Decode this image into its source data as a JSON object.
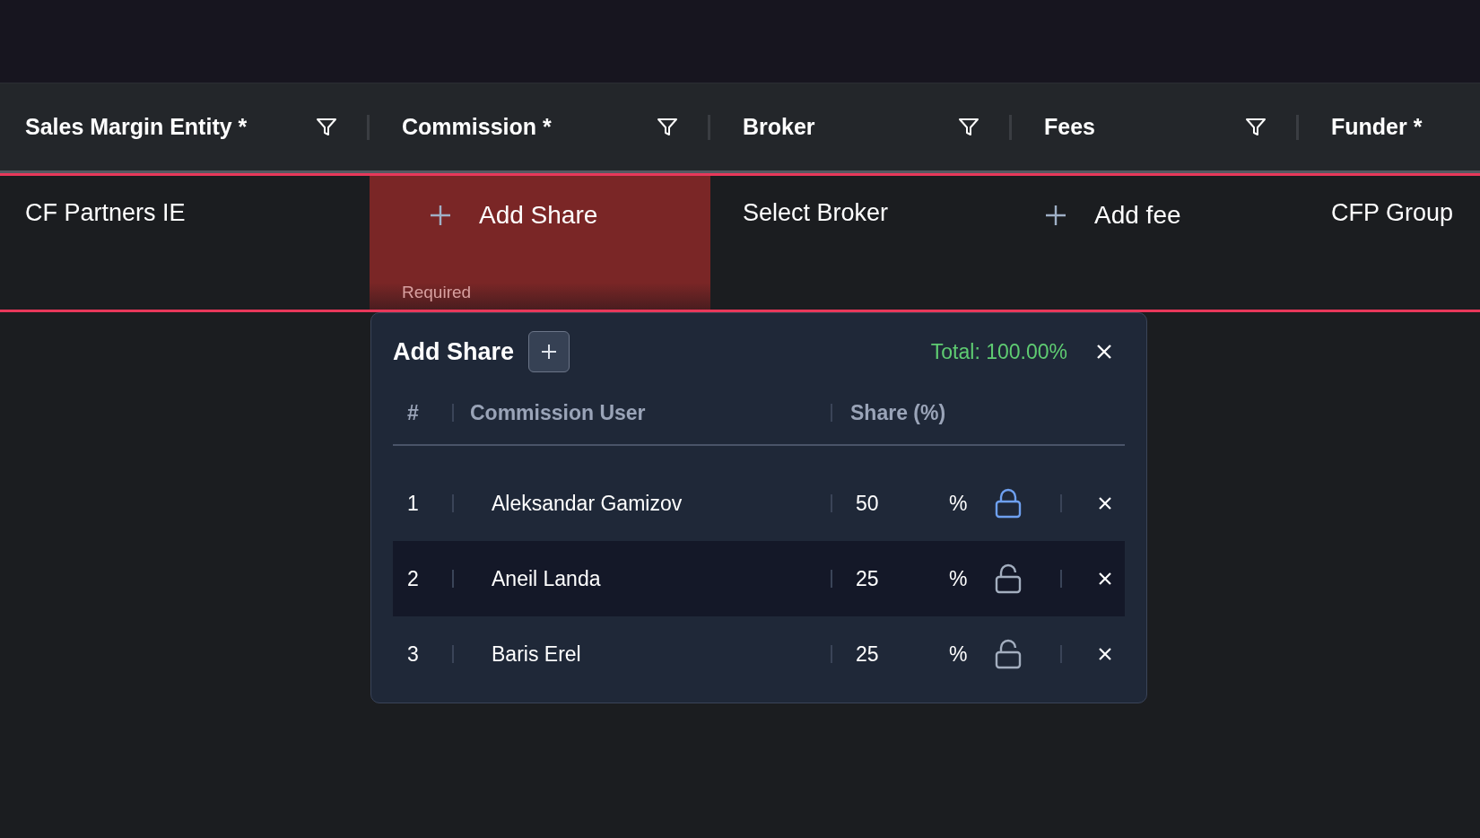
{
  "table": {
    "columns": [
      {
        "label": "Sales Margin Entity *",
        "filter": true
      },
      {
        "label": "Commission *",
        "filter": true
      },
      {
        "label": "Broker",
        "filter": true
      },
      {
        "label": "Fees",
        "filter": true
      },
      {
        "label": "Funder *",
        "filter": false
      }
    ],
    "row": [
      {
        "kind": "text",
        "text": "CF Partners IE"
      },
      {
        "kind": "add",
        "text": "Add Share",
        "error": "Required"
      },
      {
        "kind": "text",
        "text": "Select Broker"
      },
      {
        "kind": "add",
        "text": "Add fee"
      },
      {
        "kind": "text",
        "text": "CFP Group"
      }
    ]
  },
  "popup": {
    "title": "Add Share",
    "total": "Total: 100.00%",
    "columns": [
      "#",
      "Commission User",
      "Share (%)"
    ],
    "rows": [
      {
        "index": "1",
        "user": "Aleksandar Gamizov",
        "share": "50",
        "unit": "%",
        "locked": true,
        "selected": false
      },
      {
        "index": "2",
        "user": "Aneil Landa",
        "share": "25",
        "unit": "%",
        "locked": false,
        "selected": true
      },
      {
        "index": "3",
        "user": "Baris Erel",
        "share": "25",
        "unit": "%",
        "locked": false,
        "selected": false
      }
    ]
  }
}
